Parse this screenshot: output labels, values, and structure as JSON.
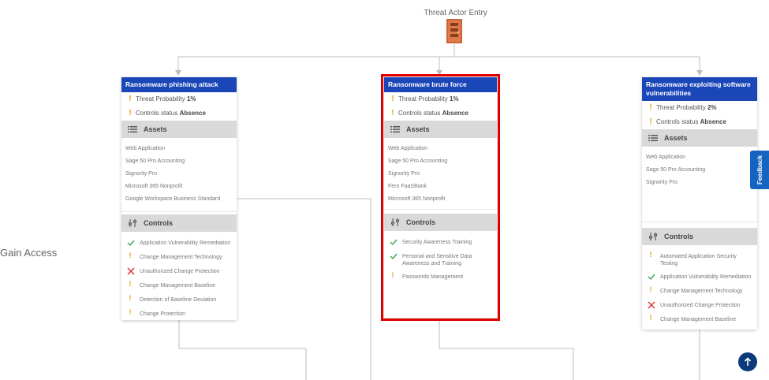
{
  "entry": {
    "title": "Threat Actor Entry"
  },
  "stage": {
    "label": "Gain Access"
  },
  "icons": {
    "entry": "door-icon",
    "warning": "warning-icon",
    "assets": "list-icon",
    "controls": "sliders-icon",
    "ok": "check-icon",
    "fail": "cross-icon",
    "feedback": "feedback-tab",
    "scroll": "arrow-up-icon"
  },
  "colors": {
    "header": "#1a46b8",
    "warning": "#e0a010",
    "ok": "#3aa757",
    "fail": "#e03030",
    "highlight": "#e00000",
    "feedback": "#1565c0"
  },
  "feedback": {
    "label": "Feedback"
  },
  "cards": [
    {
      "title": "Ransomware phishing attack",
      "probability_label": "Threat Probability",
      "probability_value": "1%",
      "controls_label": "Controls status",
      "controls_value": "Absence",
      "assets_title": "Assets",
      "assets": [
        "Web Application",
        "Sage 50 Pro Accounting",
        "Signority Pro",
        "Microsoft 365 Nonprofit",
        "Google Workspace Business Standard"
      ],
      "controls_title": "Controls",
      "controls": [
        {
          "label": "Application Vulnerability Remediation",
          "status": "ok"
        },
        {
          "label": "Change Management Technology",
          "status": "warn"
        },
        {
          "label": "Unauthorized Change Protection",
          "status": "fail"
        },
        {
          "label": "Change Management Baseline",
          "status": "warn"
        },
        {
          "label": "Detection of Baseline Deviation",
          "status": "warn"
        },
        {
          "label": "Change Protection",
          "status": "warn"
        }
      ]
    },
    {
      "title": "Ransomware brute force",
      "probability_label": "Threat Probability",
      "probability_value": "1%",
      "controls_label": "Controls status",
      "controls_value": "Absence",
      "assets_title": "Assets",
      "assets": [
        "Web Application",
        "Sage 50 Pro Accounting",
        "Signority Pro",
        "Fern FaaSBank",
        "Microsoft 365 Nonprofit"
      ],
      "controls_title": "Controls",
      "controls": [
        {
          "label": "Security Awareness Training",
          "status": "ok"
        },
        {
          "label": "Personal and Sensitive Data Awareness and Training",
          "status": "ok"
        },
        {
          "label": "Passwords Management",
          "status": "warn"
        }
      ]
    },
    {
      "title": "Ransomware exploiting software vulnerabilities",
      "probability_label": "Threat Probability",
      "probability_value": "2%",
      "controls_label": "Controls status",
      "controls_value": "Absence",
      "assets_title": "Assets",
      "assets": [
        "Web Application",
        "Sage 50 Pro Accounting",
        "Signority Pro"
      ],
      "controls_title": "Controls",
      "controls": [
        {
          "label": "Automated Application Security Testing",
          "status": "warn"
        },
        {
          "label": "Application Vulnerability Remediation",
          "status": "ok"
        },
        {
          "label": "Change Management Technology",
          "status": "warn"
        },
        {
          "label": "Unauthorized Change Protection",
          "status": "fail"
        },
        {
          "label": "Change Management Baseline",
          "status": "warn"
        }
      ]
    }
  ]
}
